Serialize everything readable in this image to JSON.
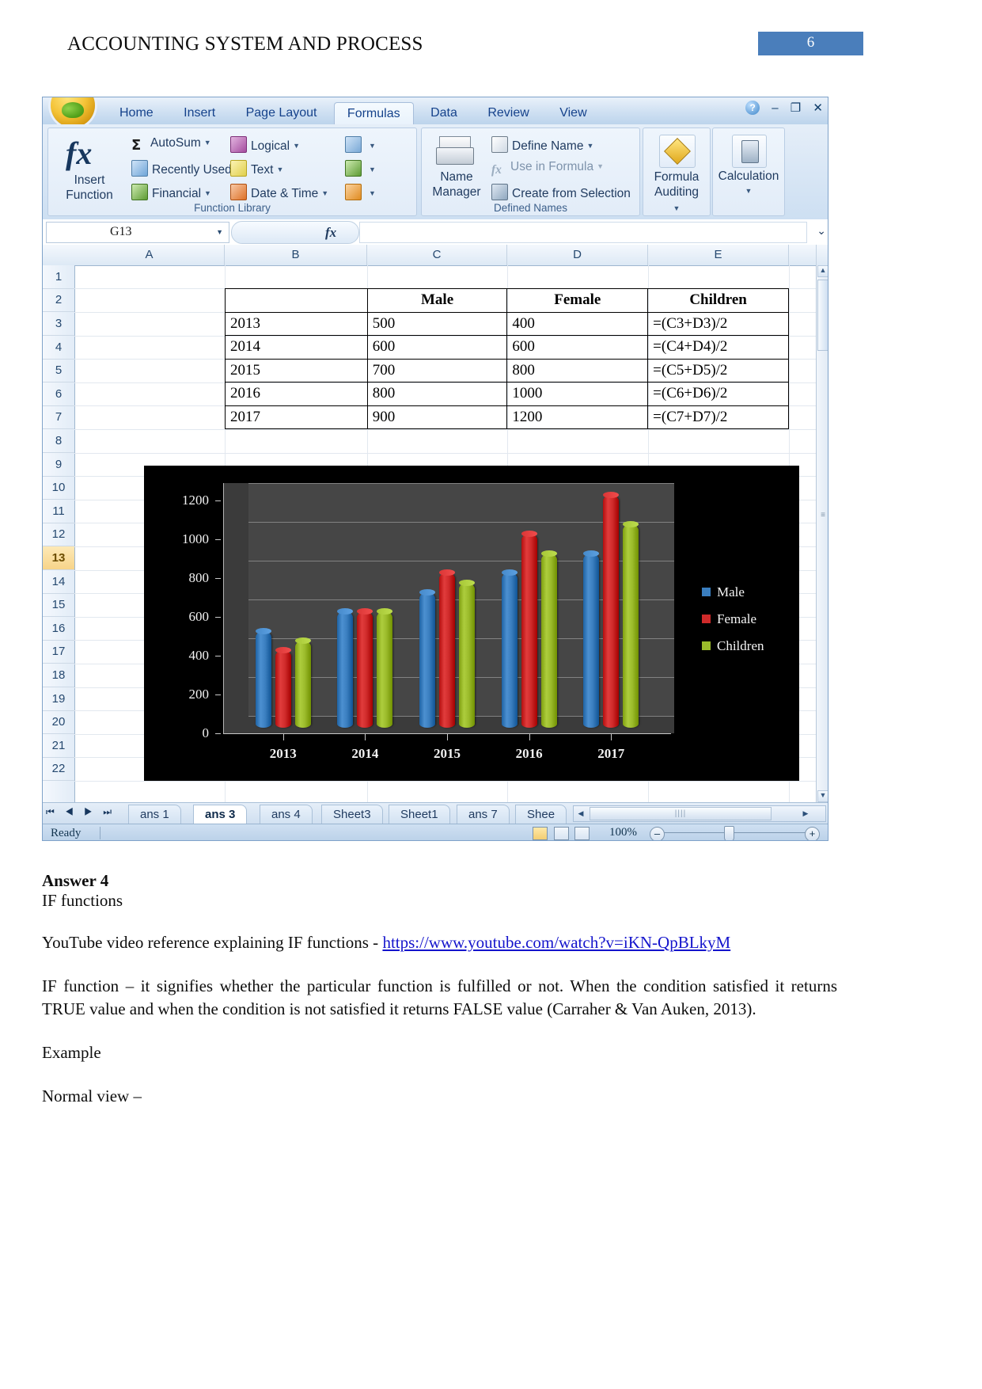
{
  "page": {
    "header_title": "ACCOUNTING SYSTEM AND PROCESS",
    "page_number": "6",
    "accent_color": "#4a7ebb"
  },
  "excel": {
    "ribbon_tabs": [
      {
        "label": "Home",
        "active": false
      },
      {
        "label": "Insert",
        "active": false
      },
      {
        "label": "Page Layout",
        "active": false
      },
      {
        "label": "Formulas",
        "active": true
      },
      {
        "label": "Data",
        "active": false
      },
      {
        "label": "Review",
        "active": false
      },
      {
        "label": "View",
        "active": false
      }
    ],
    "window_controls": {
      "help": "?",
      "minimize": "–",
      "restore": "❐",
      "close": "✕"
    },
    "groups": [
      {
        "title": "Function Library"
      },
      {
        "title": "Defined Names"
      }
    ],
    "function_library": {
      "insert_function": "Insert Function",
      "fx_symbol": "fx",
      "items": [
        {
          "label": "AutoSum",
          "icon": "sigma-icon"
        },
        {
          "label": "Recently Used",
          "icon": "recent-icon"
        },
        {
          "label": "Financial",
          "icon": "financial-icon"
        },
        {
          "label": "Logical",
          "icon": "logical-icon"
        },
        {
          "label": "Text",
          "icon": "text-icon"
        },
        {
          "label": "Date & Time",
          "icon": "date-time-icon"
        }
      ],
      "more_icons": [
        "lookup-reference-icon",
        "math-trig-icon",
        "more-functions-icon"
      ]
    },
    "defined_names": {
      "name_manager": "Name Manager",
      "items": [
        {
          "label": "Define Name",
          "disabled": false
        },
        {
          "label": "Use in Formula",
          "disabled": true
        },
        {
          "label": "Create from Selection",
          "disabled": false
        }
      ]
    },
    "formula_auditing": "Formula Auditing",
    "calculation": "Calculation",
    "formula_bar": {
      "name_box_value": "G13",
      "fx_label": "fx",
      "formula_value": ""
    },
    "grid": {
      "columns": [
        "A",
        "B",
        "C",
        "D",
        "E"
      ],
      "rows": [
        "1",
        "2",
        "3",
        "4",
        "5",
        "6",
        "7",
        "8",
        "9",
        "10",
        "11",
        "12",
        "13",
        "14",
        "15",
        "16",
        "17",
        "18",
        "19",
        "20",
        "21",
        "22"
      ],
      "selected_row": "13"
    },
    "data_table": {
      "header": [
        "",
        "Male",
        "Female",
        "Children"
      ],
      "rows": [
        [
          "2013",
          "500",
          "400",
          "=(C3+D3)/2"
        ],
        [
          "2014",
          "600",
          "600",
          "=(C4+D4)/2"
        ],
        [
          "2015",
          "700",
          "800",
          "=(C5+D5)/2"
        ],
        [
          "2016",
          "800",
          "1000",
          "=(C6+D6)/2"
        ],
        [
          "2017",
          "900",
          "1200",
          "=(C7+D7)/2"
        ]
      ]
    },
    "sheet_tabs": [
      {
        "label": "ans 1",
        "active": false
      },
      {
        "label": "ans 3",
        "active": true
      },
      {
        "label": "ans 4",
        "active": false
      },
      {
        "label": "Sheet3",
        "active": false
      },
      {
        "label": "Sheet1",
        "active": false
      },
      {
        "label": "ans 7",
        "active": false
      },
      {
        "label": "Shee",
        "active": false
      }
    ],
    "status_bar": {
      "status": "Ready",
      "zoom": "100%",
      "zoom_out": "–",
      "zoom_in": "+"
    }
  },
  "chart_data": {
    "type": "bar",
    "title": "",
    "xlabel": "",
    "ylabel": "",
    "categories": [
      "2013",
      "2014",
      "2015",
      "2016",
      "2017"
    ],
    "series": [
      {
        "name": "Male",
        "color": "#3a7ebf",
        "values": [
          500,
          600,
          700,
          800,
          900
        ]
      },
      {
        "name": "Female",
        "color": "#cf2a2a",
        "values": [
          400,
          600,
          800,
          1000,
          1200
        ]
      },
      {
        "name": "Children",
        "color": "#9bbb2b",
        "values": [
          450,
          600,
          750,
          900,
          1050
        ]
      }
    ],
    "yticks": [
      0,
      200,
      400,
      600,
      800,
      1000,
      1200
    ],
    "ylim": [
      0,
      1200
    ],
    "grid": true,
    "legend_position": "right",
    "plot_background": "#3b3b3b",
    "chart_background": "#000000"
  },
  "answer": {
    "heading": "Answer 4",
    "subheading": "IF functions",
    "video_line_prefix": "YouTube video reference explaining IF functions - ",
    "video_link": "https://www.youtube.com/watch?v=iKN-QpBLkyM",
    "description": "IF function – it signifies whether the particular function is fulfilled or not. When the condition satisfied it returns TRUE value and when the condition is not satisfied it returns FALSE value (Carraher & Van Auken, 2013).",
    "example_label": "Example",
    "normal_view_label": "Normal view –"
  }
}
